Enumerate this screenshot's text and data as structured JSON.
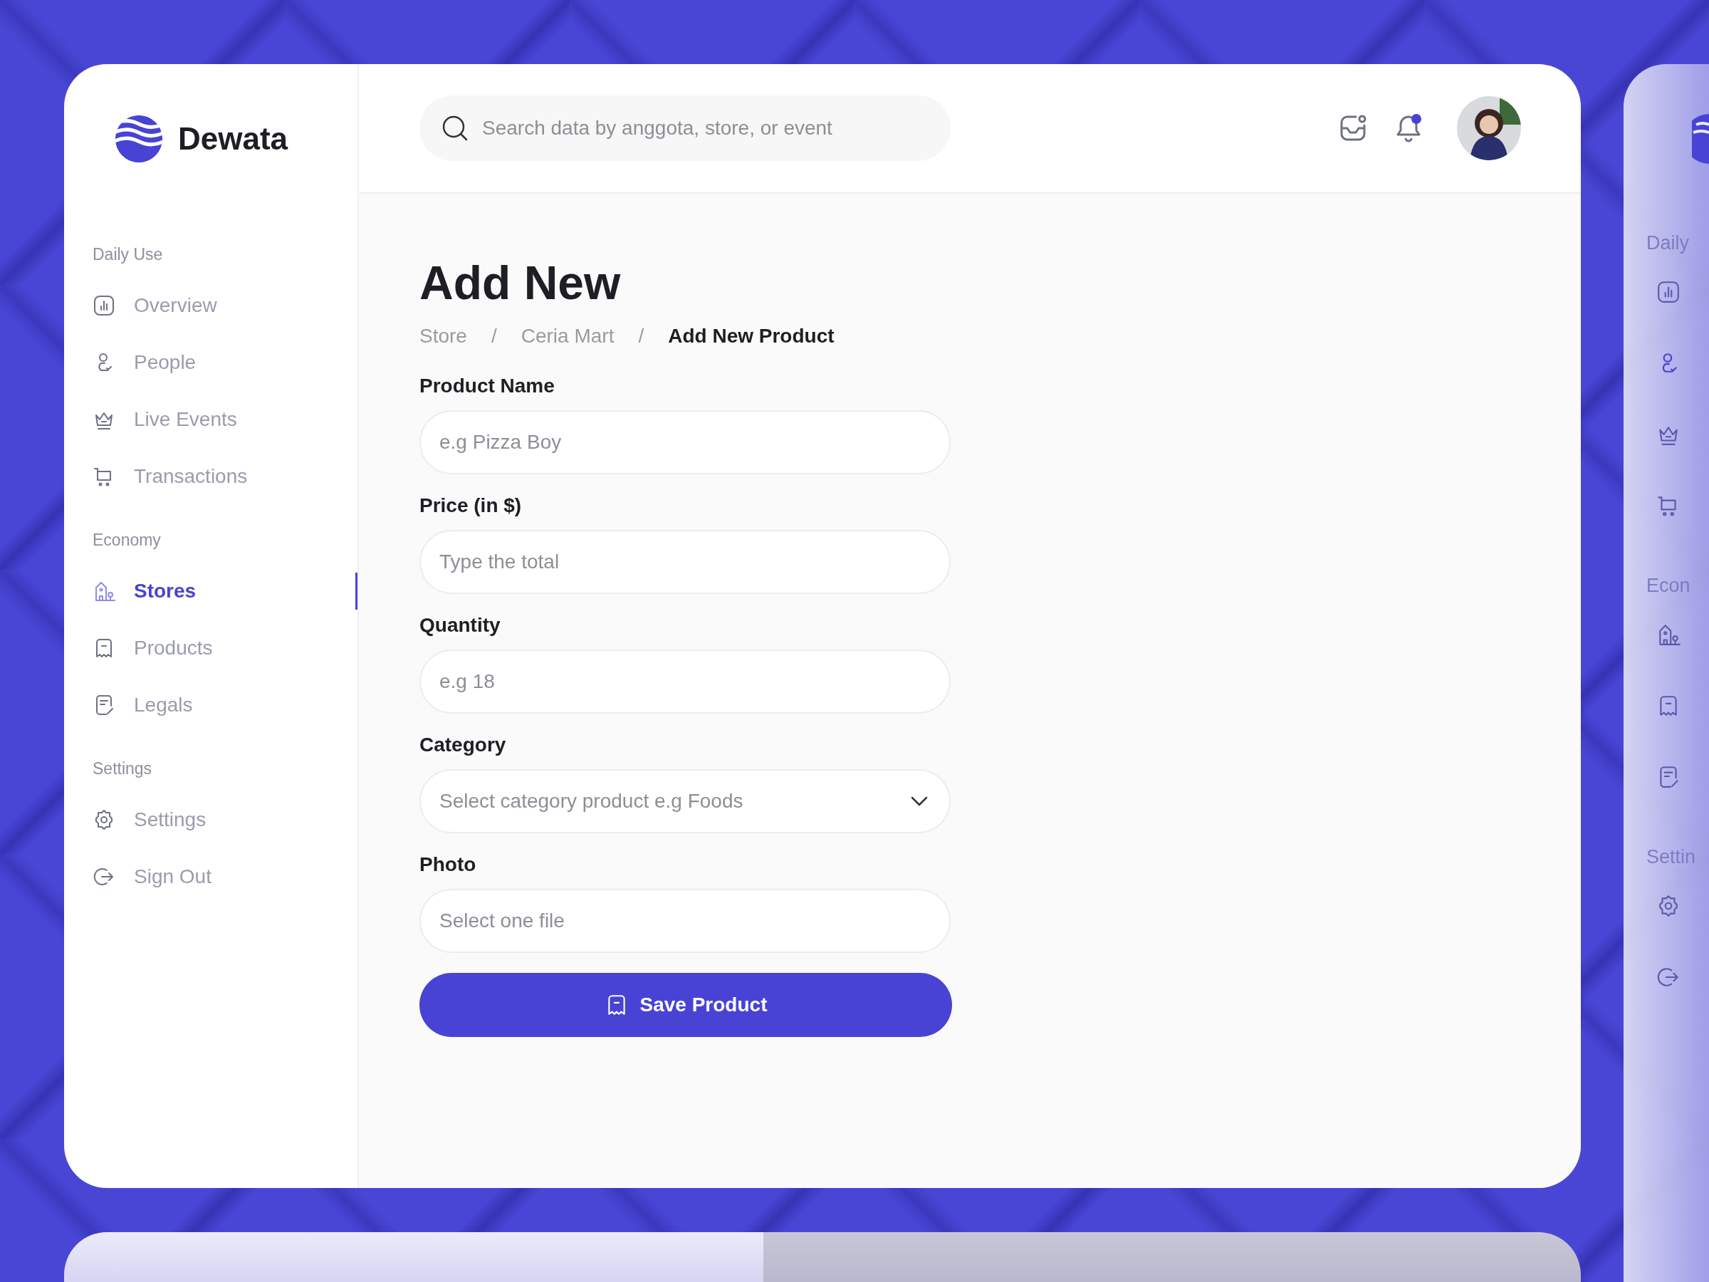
{
  "brand": {
    "name": "Dewata"
  },
  "sidebar": {
    "sections": [
      {
        "title": "Daily Use",
        "items": [
          {
            "label": "Overview",
            "selected": false
          },
          {
            "label": "People",
            "selected": false
          },
          {
            "label": "Live Events",
            "selected": false
          },
          {
            "label": "Transactions",
            "selected": false
          }
        ]
      },
      {
        "title": "Economy",
        "items": [
          {
            "label": "Stores",
            "selected": true
          },
          {
            "label": "Products",
            "selected": false
          },
          {
            "label": "Legals",
            "selected": false
          }
        ]
      },
      {
        "title": "Settings",
        "items": [
          {
            "label": "Settings",
            "selected": false
          },
          {
            "label": "Sign Out",
            "selected": false
          }
        ]
      }
    ]
  },
  "search": {
    "placeholder": "Search data by anggota, store, or event"
  },
  "notifications": {
    "unread": true
  },
  "page": {
    "title": "Add New",
    "breadcrumb": [
      {
        "kind": "link",
        "text": "Store"
      },
      {
        "kind": "separator",
        "text": "/"
      },
      {
        "kind": "link",
        "text": "Ceria Mart"
      },
      {
        "kind": "separator",
        "text": "/"
      },
      {
        "kind": "current",
        "text": "Add New Product"
      }
    ]
  },
  "form": {
    "fields": [
      {
        "kind": "text",
        "label": "Product Name",
        "placeholder": "e.g Pizza Boy"
      },
      {
        "kind": "text",
        "label": "Price (in $)",
        "placeholder": "Type the total"
      },
      {
        "kind": "text",
        "label": "Quantity",
        "placeholder": "e.g 18"
      },
      {
        "kind": "select",
        "label": "Category",
        "placeholder": "Select category product e.g Foods"
      },
      {
        "kind": "file",
        "label": "Photo",
        "placeholder": "Select one file"
      }
    ],
    "submit": "Save Product"
  },
  "peek": {
    "groups": [
      {
        "title": "Daily",
        "items": [
          {
            "selected": false
          },
          {
            "selected": true
          },
          {
            "selected": false
          },
          {
            "selected": false
          }
        ]
      },
      {
        "title": "Econ",
        "items": [
          {
            "selected": false
          },
          {
            "selected": false
          },
          {
            "selected": false
          }
        ]
      },
      {
        "title": "Settin",
        "items": [
          {
            "selected": false
          },
          {
            "selected": false
          }
        ]
      }
    ]
  }
}
